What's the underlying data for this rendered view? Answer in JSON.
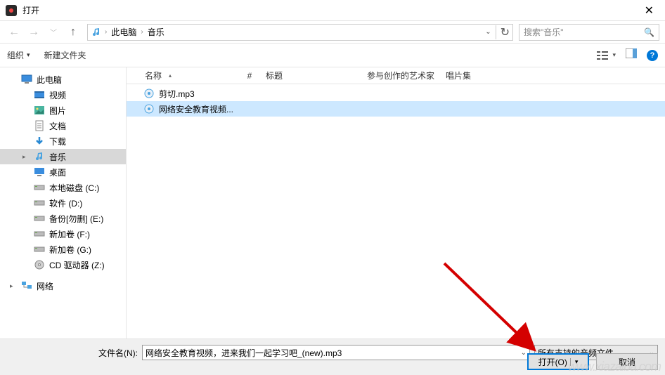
{
  "title": "打开",
  "path": {
    "root": "此电脑",
    "folder": "音乐"
  },
  "search_placeholder": "搜索\"音乐\"",
  "toolbar": {
    "organize": "组织",
    "new_folder": "新建文件夹"
  },
  "columns": {
    "name": "名称",
    "num": "#",
    "title": "标题",
    "artist": "参与创作的艺术家",
    "album": "唱片集"
  },
  "sidebar": {
    "this_pc": "此电脑",
    "items": [
      {
        "label": "视频",
        "icon": "video"
      },
      {
        "label": "图片",
        "icon": "picture"
      },
      {
        "label": "文档",
        "icon": "doc"
      },
      {
        "label": "下载",
        "icon": "download"
      },
      {
        "label": "音乐",
        "icon": "music",
        "selected": true
      },
      {
        "label": "桌面",
        "icon": "desktop"
      },
      {
        "label": "本地磁盘 (C:)",
        "icon": "drive"
      },
      {
        "label": "软件 (D:)",
        "icon": "drive"
      },
      {
        "label": "备份[勿删] (E:)",
        "icon": "drive"
      },
      {
        "label": "新加卷 (F:)",
        "icon": "drive"
      },
      {
        "label": "新加卷 (G:)",
        "icon": "drive"
      },
      {
        "label": "CD 驱动器 (Z:)",
        "icon": "cd"
      }
    ],
    "network": "网络"
  },
  "files": [
    {
      "name": "剪切.mp3",
      "selected": false
    },
    {
      "name": "网络安全教育视频...",
      "selected": true
    }
  ],
  "filename_label": "文件名(N):",
  "filename_value": "网络安全教育视频，进来我们一起学习吧_(new).mp3",
  "filter": "所有支持的音频文件",
  "open_btn": "打开(O)",
  "cancel_btn": "取消",
  "watermark": "www.xiazaiba.com"
}
